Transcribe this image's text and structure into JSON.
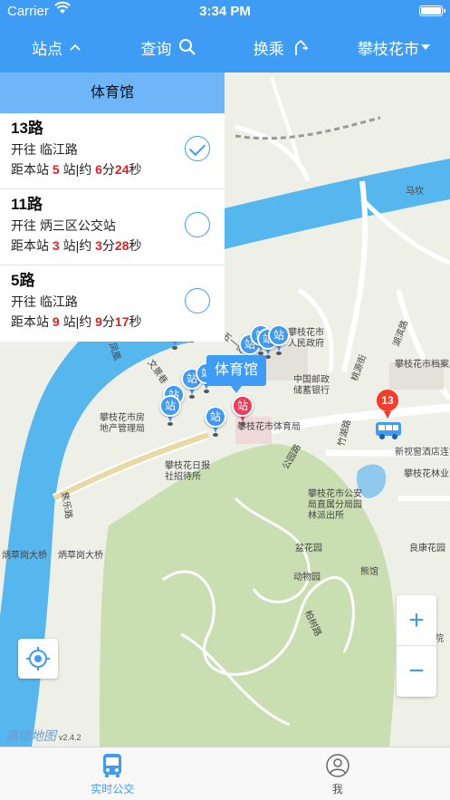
{
  "status_bar": {
    "carrier": "Carrier",
    "time": "3:34 PM"
  },
  "nav": {
    "stations_label": "站点",
    "search_label": "查询",
    "transfer_label": "换乘",
    "city_label": "攀枝花市"
  },
  "panel": {
    "title": "体育馆",
    "routes": [
      {
        "name": "13路",
        "dest_prefix": "开往 ",
        "dest": "临江路",
        "dist_prefix": "距本站 ",
        "stops": "5",
        "stops_unit": " 站|约 ",
        "min": "6",
        "min_unit": "分",
        "sec": "24",
        "sec_unit": "秒",
        "selected": true
      },
      {
        "name": "11路",
        "dest_prefix": "开往 ",
        "dest": "炳三区公交站",
        "dist_prefix": "距本站 ",
        "stops": "3",
        "stops_unit": " 站|约 ",
        "min": "3",
        "min_unit": "分",
        "sec": "28",
        "sec_unit": "秒",
        "selected": false
      },
      {
        "name": "5路",
        "dest_prefix": "开往 ",
        "dest": "临江路",
        "dist_prefix": "距本站 ",
        "stops": "9",
        "stops_unit": " 站|约 ",
        "min": "9",
        "min_unit": "分",
        "sec": "17",
        "sec_unit": "秒",
        "selected": false
      }
    ]
  },
  "map": {
    "callout": "体育馆",
    "pin_label": "站",
    "bus_number": "13",
    "brand": "高德地图",
    "version": "v2.4.2",
    "zoom_in": "+",
    "zoom_out": "−",
    "labels": [
      "马坎",
      "攀枝花市",
      "人民政府",
      "中国邮政",
      "储蓄银行",
      "攀枝花市档案局",
      "新视窗酒店连锁",
      "攀枝花林业",
      "攀枝花市房",
      "地产管理局",
      "攀枝花市体育局",
      "攀枝花日报",
      "社招待所",
      "攀枝花市公安",
      "局直属分局园",
      "林派出所",
      "盆花园",
      "动物园",
      "熊馆",
      "良康花园",
      "炳草岗大桥",
      "炳草岗大桥",
      "攀枝化学院",
      "湖滨路",
      "五一街",
      "公园路",
      "竹湖路",
      "文景巷",
      "桃源街",
      "凤凰",
      "焦乐路",
      "柏树路"
    ]
  },
  "tabs": {
    "realtime": "实时公交",
    "me": "我"
  },
  "colors": {
    "primary": "#3f9cf5",
    "panel_header": "#6eb6f8",
    "accent_red": "#e41e1e",
    "river": "#56b7ef",
    "park": "#c9dfb1"
  }
}
